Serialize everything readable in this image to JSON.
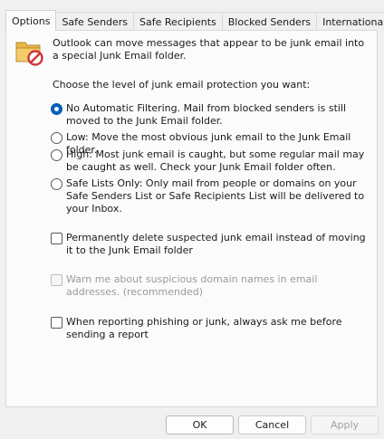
{
  "tabs": [
    {
      "label": "Options",
      "active": true
    },
    {
      "label": "Safe Senders",
      "active": false
    },
    {
      "label": "Safe Recipients",
      "active": false
    },
    {
      "label": "Blocked Senders",
      "active": false
    },
    {
      "label": "International",
      "active": false
    }
  ],
  "header": {
    "icon": "junk-folder-icon",
    "text": "Outlook can move messages that appear to be junk email into a special Junk Email folder."
  },
  "prompt": "Choose the level of junk email protection you want:",
  "protection_levels": [
    {
      "label": "No Automatic Filtering. Mail from blocked senders is still moved to the Junk Email folder.",
      "selected": true
    },
    {
      "label": "Low: Move the most obvious junk email to the Junk Email folder.",
      "selected": false
    },
    {
      "label": "High: Most junk email is caught, but some regular mail may be caught as well. Check your Junk Email folder often.",
      "selected": false
    },
    {
      "label": "Safe Lists Only: Only mail from people or domains on your Safe Senders List or Safe Recipients List will be delivered to your Inbox.",
      "selected": false
    }
  ],
  "checkboxes": {
    "permanently_delete": {
      "label": "Permanently delete suspected junk email instead of moving it to the Junk Email folder",
      "checked": false,
      "enabled": true
    },
    "warn_domains": {
      "label": "Warn me about suspicious domain names in email addresses. (recommended)",
      "checked": false,
      "enabled": false
    },
    "ask_before_report": {
      "label": "When reporting phishing or junk, always ask me before sending a report",
      "checked": false,
      "enabled": true
    }
  },
  "buttons": {
    "ok": "OK",
    "cancel": "Cancel",
    "apply": "Apply"
  },
  "colors": {
    "accent": "#005fb8",
    "folder": "#e8b84a",
    "no_sign": "#d13438"
  }
}
